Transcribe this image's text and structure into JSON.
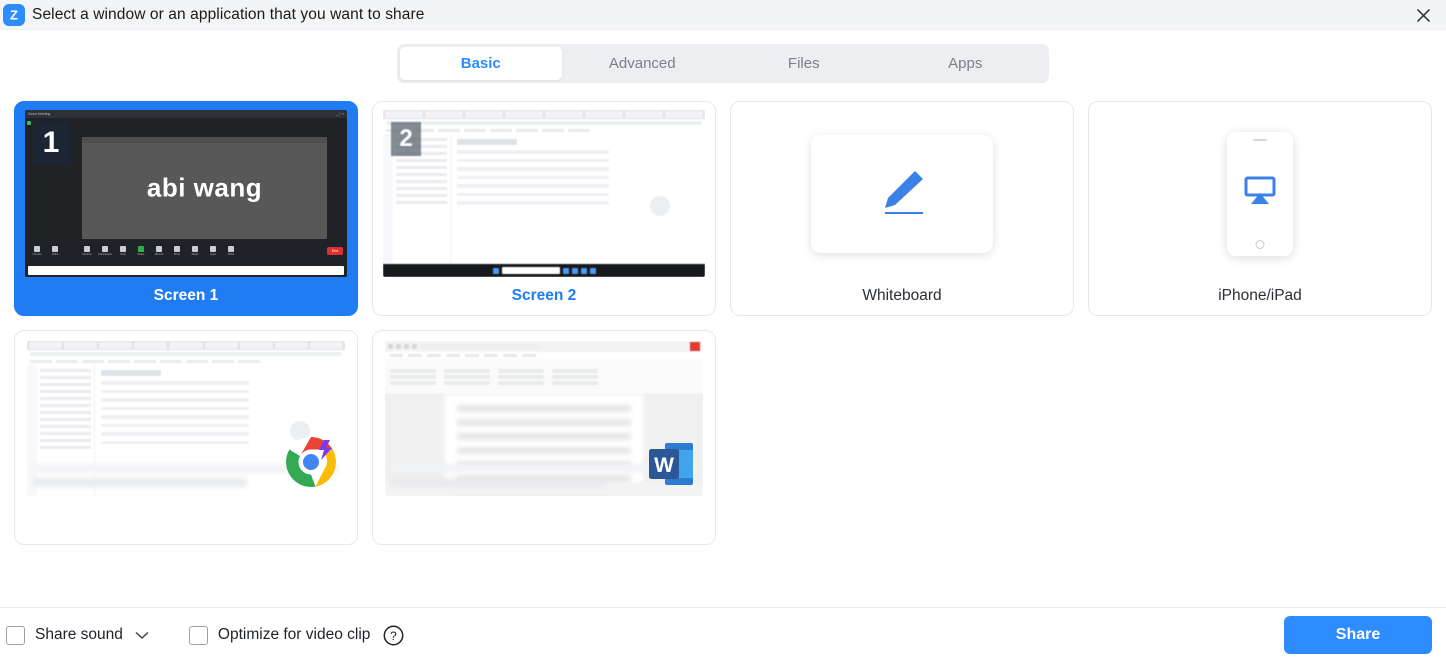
{
  "titlebar": {
    "app_icon": "zoom-logo-icon",
    "title": "Select a window or an application that you want to share",
    "close_icon": "close-icon"
  },
  "tabs": [
    {
      "label": "Basic",
      "active": true
    },
    {
      "label": "Advanced",
      "active": false
    },
    {
      "label": "Files",
      "active": false
    },
    {
      "label": "Apps",
      "active": false
    }
  ],
  "sources": [
    {
      "label": "Screen 1",
      "selected": true,
      "badge": "1",
      "kind": "screen",
      "preview_text": "abi wang"
    },
    {
      "label": "Screen 2",
      "selected": false,
      "badge": "2",
      "kind": "screen"
    },
    {
      "label": "Whiteboard",
      "selected": false,
      "kind": "whiteboard",
      "icon": "pen-icon"
    },
    {
      "label": "iPhone/iPad",
      "selected": false,
      "kind": "airplay",
      "icon": "airplay-icon"
    },
    {
      "label": "",
      "selected": false,
      "kind": "window",
      "app": "Google Chrome",
      "app_icon": "chrome-icon"
    },
    {
      "label": "",
      "selected": false,
      "kind": "window",
      "app": "Microsoft Word",
      "app_icon": "word-icon"
    }
  ],
  "footer": {
    "share_sound": {
      "label": "Share sound",
      "checked": false
    },
    "share_sound_dropdown_icon": "chevron-down-icon",
    "optimize_video": {
      "label": "Optimize for video clip",
      "checked": false
    },
    "help_icon": "help-circle-icon",
    "share_button": "Share"
  },
  "colors": {
    "accent_blue": "#2d8cff",
    "selected_card_blue": "#1f7cf2",
    "titlebar_bg": "#f3f4f6",
    "tabstrip_bg": "#eceef2",
    "text_dark": "#1f2328",
    "text_muted": "#7a7f88"
  }
}
